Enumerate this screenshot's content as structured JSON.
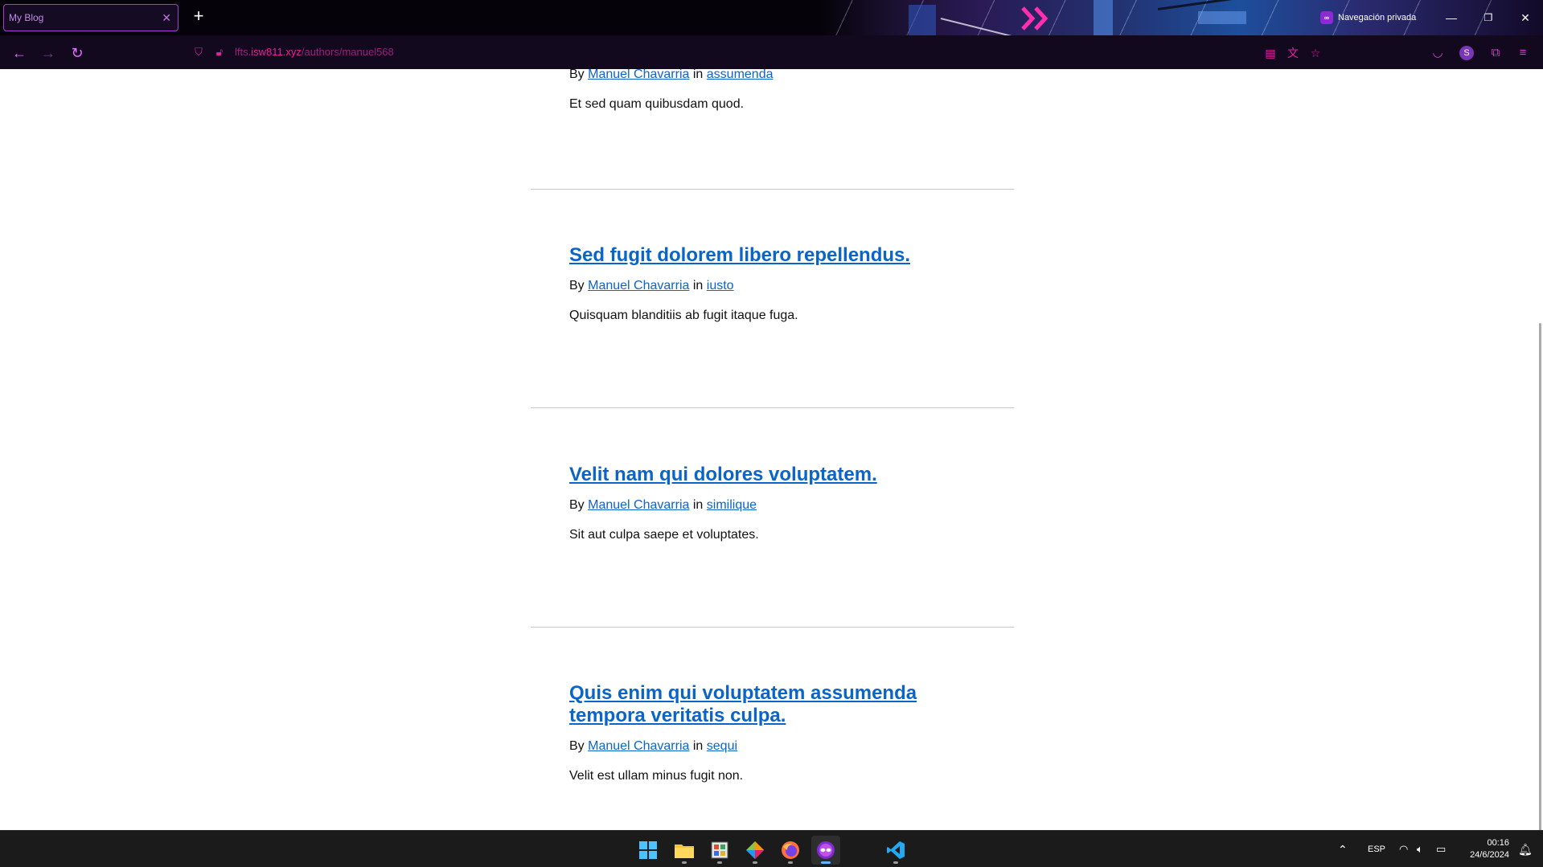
{
  "browser": {
    "tab_title": "My Blog",
    "tab_close": "✕",
    "new_tab": "+",
    "private_label": "Navegación privada",
    "url_prefix": "lfts.",
    "url_host": "isw811.xyz",
    "url_path": "/authors/manuel568",
    "accent_color": "#e81e9b"
  },
  "posts": [
    {
      "title": "",
      "author": "Manuel Chavarria",
      "category": "assumenda",
      "excerpt": "Et sed quam quibusdam quod."
    },
    {
      "title": "Sed fugit dolorem libero repellendus.",
      "author": "Manuel Chavarria",
      "category": "iusto",
      "excerpt": "Quisquam blanditiis ab fugit itaque fuga."
    },
    {
      "title": "Velit nam qui dolores voluptatem.",
      "author": "Manuel Chavarria",
      "category": "similique",
      "excerpt": "Sit aut culpa saepe et voluptates."
    },
    {
      "title_line1": "Quis enim qui voluptatem assumenda",
      "title_line2": "tempora veritatis culpa.",
      "author": "Manuel Chavarria",
      "category": "sequi",
      "excerpt": "Velit est ullam minus fugit non."
    }
  ],
  "meta_labels": {
    "by": "By",
    "in": "in"
  },
  "link_color": "#0b64c8",
  "taskbar": {
    "apps": [
      "windows-start-icon",
      "file-explorer-icon",
      "app-icon",
      "git-icon",
      "firefox-icon",
      "firefox-private-icon",
      "vscode-icon"
    ],
    "language": "ESP",
    "time": "00:16",
    "date": "24/6/2024"
  }
}
